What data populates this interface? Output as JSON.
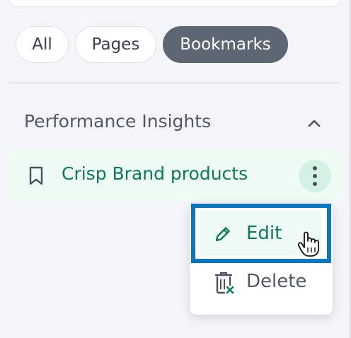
{
  "filter_tabs": [
    {
      "label": "All"
    },
    {
      "label": "Pages"
    },
    {
      "label": "Bookmarks",
      "active": true
    }
  ],
  "section": {
    "title": "Performance Insights",
    "collapse_icon": "chevron-up-icon",
    "bookmark": {
      "label": "Crisp Brand products",
      "icon": "bookmark-icon"
    }
  },
  "context_menu": {
    "edit": {
      "label": "Edit",
      "icon": "pencil-icon"
    },
    "delete": {
      "label": "Delete",
      "icon": "trash-icon"
    }
  },
  "colors": {
    "accent": "#0d7a56",
    "active_tab": "#5d6673",
    "highlight_frame": "#0a76bf",
    "row_background": "#eefbf5"
  }
}
